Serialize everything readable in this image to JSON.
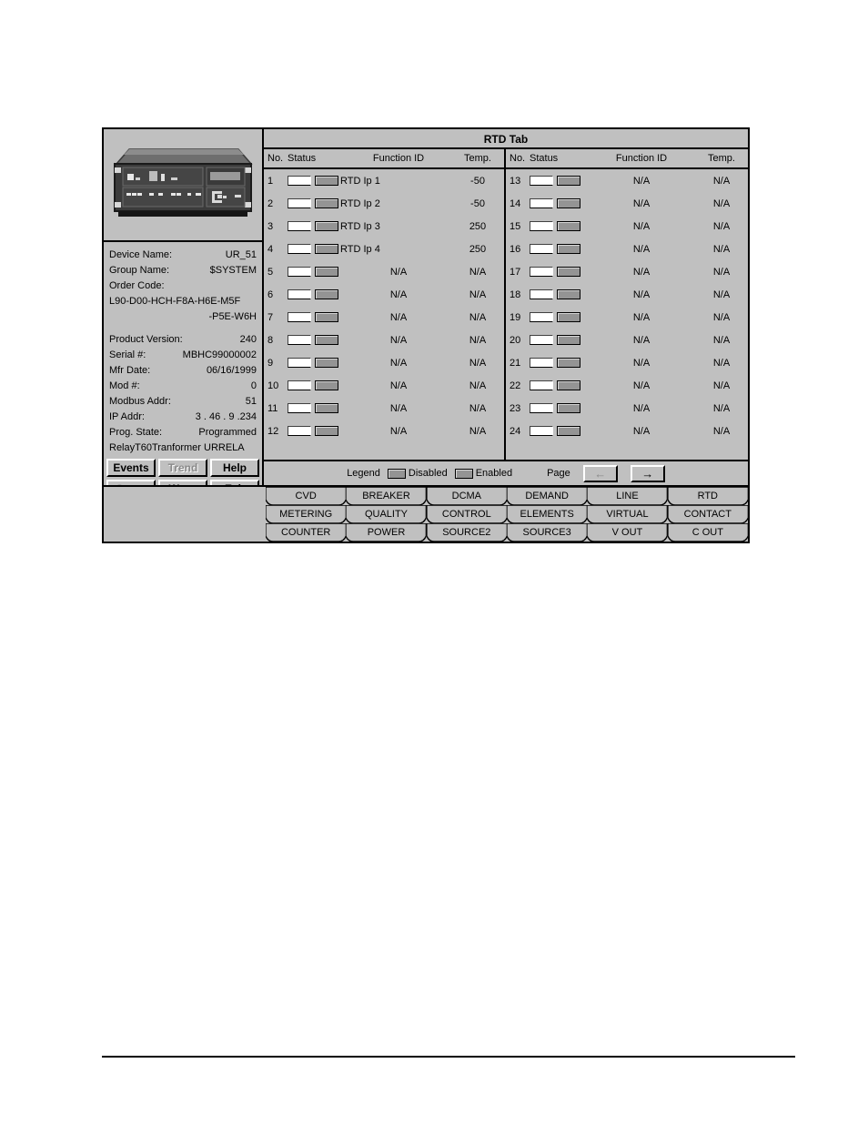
{
  "window": {
    "tab_title": "RTD Tab"
  },
  "device": {
    "image_alt": "ur-relay-front-panel",
    "fields": [
      {
        "label": "Device Name:",
        "value": "UR_51"
      },
      {
        "label": "Group Name:",
        "value": "$SYSTEM"
      },
      {
        "label": "Order Code:",
        "value": ""
      },
      {
        "label": "Product Version:",
        "value": "240"
      },
      {
        "label": "Serial #:",
        "value": "MBHC99000002"
      },
      {
        "label": "Mfr Date:",
        "value": "06/16/1999"
      },
      {
        "label": "Mod #:",
        "value": "0"
      },
      {
        "label": "Modbus Addr:",
        "value": "51"
      },
      {
        "label": "IP Addr:",
        "value": "3 .  46 .   9 .234"
      },
      {
        "label": "Prog. State:",
        "value": "Programmed"
      }
    ],
    "order_code_line1": "L90-D00-HCH-F8A-H6E-M5F",
    "order_code_line2": "-P5E-W6H",
    "relay_type_label": "Relay",
    "relay_type_value": "T60Tranformer URRELA"
  },
  "left_buttons": [
    {
      "label": "Events",
      "enabled": true
    },
    {
      "label": "Trend",
      "enabled": false
    },
    {
      "label": "Help",
      "enabled": true
    },
    {
      "label": "Setup",
      "enabled": false
    },
    {
      "label": "Wave",
      "enabled": true
    },
    {
      "label": "Exit",
      "enabled": true
    }
  ],
  "table": {
    "headers": {
      "no": "No.",
      "status": "Status",
      "function_id": "Function ID",
      "temp": "Temp."
    },
    "left_rows": [
      {
        "no": "1",
        "off": true,
        "on": true,
        "function_id": "RTD Ip 1",
        "temp": "-50",
        "labeled": true
      },
      {
        "no": "2",
        "off": true,
        "on": true,
        "function_id": "RTD Ip 2",
        "temp": "-50",
        "labeled": true
      },
      {
        "no": "3",
        "off": true,
        "on": true,
        "function_id": "RTD Ip 3",
        "temp": "250",
        "labeled": true
      },
      {
        "no": "4",
        "off": true,
        "on": true,
        "function_id": "RTD Ip 4",
        "temp": "250",
        "labeled": true
      },
      {
        "no": "5",
        "off": true,
        "on": true,
        "function_id": "N/A",
        "temp": "N/A",
        "labeled": false
      },
      {
        "no": "6",
        "off": true,
        "on": true,
        "function_id": "N/A",
        "temp": "N/A",
        "labeled": false
      },
      {
        "no": "7",
        "off": true,
        "on": true,
        "function_id": "N/A",
        "temp": "N/A",
        "labeled": false
      },
      {
        "no": "8",
        "off": true,
        "on": true,
        "function_id": "N/A",
        "temp": "N/A",
        "labeled": false
      },
      {
        "no": "9",
        "off": true,
        "on": true,
        "function_id": "N/A",
        "temp": "N/A",
        "labeled": false
      },
      {
        "no": "10",
        "off": true,
        "on": true,
        "function_id": "N/A",
        "temp": "N/A",
        "labeled": false
      },
      {
        "no": "11",
        "off": true,
        "on": true,
        "function_id": "N/A",
        "temp": "N/A",
        "labeled": false
      },
      {
        "no": "12",
        "off": true,
        "on": true,
        "function_id": "N/A",
        "temp": "N/A",
        "labeled": false
      }
    ],
    "right_rows": [
      {
        "no": "13",
        "off": true,
        "on": true,
        "function_id": "N/A",
        "temp": "N/A",
        "labeled": false
      },
      {
        "no": "14",
        "off": true,
        "on": true,
        "function_id": "N/A",
        "temp": "N/A",
        "labeled": false
      },
      {
        "no": "15",
        "off": true,
        "on": true,
        "function_id": "N/A",
        "temp": "N/A",
        "labeled": false
      },
      {
        "no": "16",
        "off": true,
        "on": true,
        "function_id": "N/A",
        "temp": "N/A",
        "labeled": false
      },
      {
        "no": "17",
        "off": true,
        "on": true,
        "function_id": "N/A",
        "temp": "N/A",
        "labeled": false
      },
      {
        "no": "18",
        "off": true,
        "on": true,
        "function_id": "N/A",
        "temp": "N/A",
        "labeled": false
      },
      {
        "no": "19",
        "off": true,
        "on": true,
        "function_id": "N/A",
        "temp": "N/A",
        "labeled": false
      },
      {
        "no": "20",
        "off": true,
        "on": true,
        "function_id": "N/A",
        "temp": "N/A",
        "labeled": false
      },
      {
        "no": "21",
        "off": true,
        "on": true,
        "function_id": "N/A",
        "temp": "N/A",
        "labeled": false
      },
      {
        "no": "22",
        "off": true,
        "on": true,
        "function_id": "N/A",
        "temp": "N/A",
        "labeled": false
      },
      {
        "no": "23",
        "off": true,
        "on": true,
        "function_id": "N/A",
        "temp": "N/A",
        "labeled": false
      },
      {
        "no": "24",
        "off": true,
        "on": true,
        "function_id": "N/A",
        "temp": "N/A",
        "labeled": false
      }
    ]
  },
  "legend": {
    "title": "Legend",
    "disabled_label": "Disabled",
    "enabled_label": "Enabled",
    "page_label": "Page",
    "prev_icon": "left-arrow",
    "next_icon": "right-arrow",
    "prev_enabled": false,
    "next_enabled": true
  },
  "tabs": [
    {
      "col": [
        "CVD",
        "METERING",
        "COUNTER"
      ]
    },
    {
      "col": [
        "BREAKER",
        "QUALITY",
        "POWER"
      ]
    },
    {
      "col": [
        "DCMA",
        "CONTROL",
        "SOURCE2"
      ]
    },
    {
      "col": [
        "DEMAND",
        "ELEMENTS",
        "SOURCE3"
      ]
    },
    {
      "col": [
        "LINE",
        "VIRTUAL",
        "V OUT"
      ]
    },
    {
      "col": [
        "RTD",
        "CONTACT",
        "C OUT"
      ]
    }
  ],
  "colors": {
    "face": "#c0c0c0",
    "shadow": "#808080",
    "highlight": "#ffffff",
    "text": "#000000",
    "disabled_text": "#8a8a8a",
    "indicator_on": "#949494",
    "indicator_off": "#ffffff"
  }
}
